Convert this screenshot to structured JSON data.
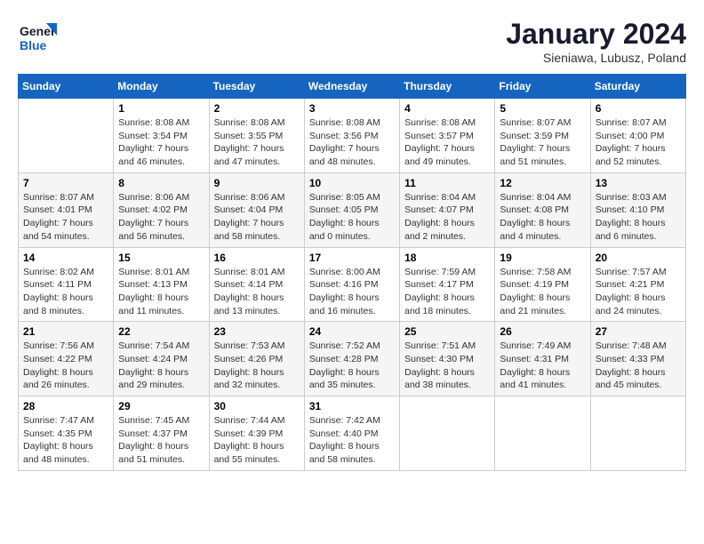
{
  "header": {
    "logo_line1": "General",
    "logo_line2": "Blue",
    "month_title": "January 2024",
    "subtitle": "Sieniawa, Lubusz, Poland"
  },
  "weekdays": [
    "Sunday",
    "Monday",
    "Tuesday",
    "Wednesday",
    "Thursday",
    "Friday",
    "Saturday"
  ],
  "weeks": [
    [
      {
        "num": "",
        "sunrise": "",
        "sunset": "",
        "daylight": ""
      },
      {
        "num": "1",
        "sunrise": "Sunrise: 8:08 AM",
        "sunset": "Sunset: 3:54 PM",
        "daylight": "Daylight: 7 hours and 46 minutes."
      },
      {
        "num": "2",
        "sunrise": "Sunrise: 8:08 AM",
        "sunset": "Sunset: 3:55 PM",
        "daylight": "Daylight: 7 hours and 47 minutes."
      },
      {
        "num": "3",
        "sunrise": "Sunrise: 8:08 AM",
        "sunset": "Sunset: 3:56 PM",
        "daylight": "Daylight: 7 hours and 48 minutes."
      },
      {
        "num": "4",
        "sunrise": "Sunrise: 8:08 AM",
        "sunset": "Sunset: 3:57 PM",
        "daylight": "Daylight: 7 hours and 49 minutes."
      },
      {
        "num": "5",
        "sunrise": "Sunrise: 8:07 AM",
        "sunset": "Sunset: 3:59 PM",
        "daylight": "Daylight: 7 hours and 51 minutes."
      },
      {
        "num": "6",
        "sunrise": "Sunrise: 8:07 AM",
        "sunset": "Sunset: 4:00 PM",
        "daylight": "Daylight: 7 hours and 52 minutes."
      }
    ],
    [
      {
        "num": "7",
        "sunrise": "Sunrise: 8:07 AM",
        "sunset": "Sunset: 4:01 PM",
        "daylight": "Daylight: 7 hours and 54 minutes."
      },
      {
        "num": "8",
        "sunrise": "Sunrise: 8:06 AM",
        "sunset": "Sunset: 4:02 PM",
        "daylight": "Daylight: 7 hours and 56 minutes."
      },
      {
        "num": "9",
        "sunrise": "Sunrise: 8:06 AM",
        "sunset": "Sunset: 4:04 PM",
        "daylight": "Daylight: 7 hours and 58 minutes."
      },
      {
        "num": "10",
        "sunrise": "Sunrise: 8:05 AM",
        "sunset": "Sunset: 4:05 PM",
        "daylight": "Daylight: 8 hours and 0 minutes."
      },
      {
        "num": "11",
        "sunrise": "Sunrise: 8:04 AM",
        "sunset": "Sunset: 4:07 PM",
        "daylight": "Daylight: 8 hours and 2 minutes."
      },
      {
        "num": "12",
        "sunrise": "Sunrise: 8:04 AM",
        "sunset": "Sunset: 4:08 PM",
        "daylight": "Daylight: 8 hours and 4 minutes."
      },
      {
        "num": "13",
        "sunrise": "Sunrise: 8:03 AM",
        "sunset": "Sunset: 4:10 PM",
        "daylight": "Daylight: 8 hours and 6 minutes."
      }
    ],
    [
      {
        "num": "14",
        "sunrise": "Sunrise: 8:02 AM",
        "sunset": "Sunset: 4:11 PM",
        "daylight": "Daylight: 8 hours and 8 minutes."
      },
      {
        "num": "15",
        "sunrise": "Sunrise: 8:01 AM",
        "sunset": "Sunset: 4:13 PM",
        "daylight": "Daylight: 8 hours and 11 minutes."
      },
      {
        "num": "16",
        "sunrise": "Sunrise: 8:01 AM",
        "sunset": "Sunset: 4:14 PM",
        "daylight": "Daylight: 8 hours and 13 minutes."
      },
      {
        "num": "17",
        "sunrise": "Sunrise: 8:00 AM",
        "sunset": "Sunset: 4:16 PM",
        "daylight": "Daylight: 8 hours and 16 minutes."
      },
      {
        "num": "18",
        "sunrise": "Sunrise: 7:59 AM",
        "sunset": "Sunset: 4:17 PM",
        "daylight": "Daylight: 8 hours and 18 minutes."
      },
      {
        "num": "19",
        "sunrise": "Sunrise: 7:58 AM",
        "sunset": "Sunset: 4:19 PM",
        "daylight": "Daylight: 8 hours and 21 minutes."
      },
      {
        "num": "20",
        "sunrise": "Sunrise: 7:57 AM",
        "sunset": "Sunset: 4:21 PM",
        "daylight": "Daylight: 8 hours and 24 minutes."
      }
    ],
    [
      {
        "num": "21",
        "sunrise": "Sunrise: 7:56 AM",
        "sunset": "Sunset: 4:22 PM",
        "daylight": "Daylight: 8 hours and 26 minutes."
      },
      {
        "num": "22",
        "sunrise": "Sunrise: 7:54 AM",
        "sunset": "Sunset: 4:24 PM",
        "daylight": "Daylight: 8 hours and 29 minutes."
      },
      {
        "num": "23",
        "sunrise": "Sunrise: 7:53 AM",
        "sunset": "Sunset: 4:26 PM",
        "daylight": "Daylight: 8 hours and 32 minutes."
      },
      {
        "num": "24",
        "sunrise": "Sunrise: 7:52 AM",
        "sunset": "Sunset: 4:28 PM",
        "daylight": "Daylight: 8 hours and 35 minutes."
      },
      {
        "num": "25",
        "sunrise": "Sunrise: 7:51 AM",
        "sunset": "Sunset: 4:30 PM",
        "daylight": "Daylight: 8 hours and 38 minutes."
      },
      {
        "num": "26",
        "sunrise": "Sunrise: 7:49 AM",
        "sunset": "Sunset: 4:31 PM",
        "daylight": "Daylight: 8 hours and 41 minutes."
      },
      {
        "num": "27",
        "sunrise": "Sunrise: 7:48 AM",
        "sunset": "Sunset: 4:33 PM",
        "daylight": "Daylight: 8 hours and 45 minutes."
      }
    ],
    [
      {
        "num": "28",
        "sunrise": "Sunrise: 7:47 AM",
        "sunset": "Sunset: 4:35 PM",
        "daylight": "Daylight: 8 hours and 48 minutes."
      },
      {
        "num": "29",
        "sunrise": "Sunrise: 7:45 AM",
        "sunset": "Sunset: 4:37 PM",
        "daylight": "Daylight: 8 hours and 51 minutes."
      },
      {
        "num": "30",
        "sunrise": "Sunrise: 7:44 AM",
        "sunset": "Sunset: 4:39 PM",
        "daylight": "Daylight: 8 hours and 55 minutes."
      },
      {
        "num": "31",
        "sunrise": "Sunrise: 7:42 AM",
        "sunset": "Sunset: 4:40 PM",
        "daylight": "Daylight: 8 hours and 58 minutes."
      },
      {
        "num": "",
        "sunrise": "",
        "sunset": "",
        "daylight": ""
      },
      {
        "num": "",
        "sunrise": "",
        "sunset": "",
        "daylight": ""
      },
      {
        "num": "",
        "sunrise": "",
        "sunset": "",
        "daylight": ""
      }
    ]
  ]
}
